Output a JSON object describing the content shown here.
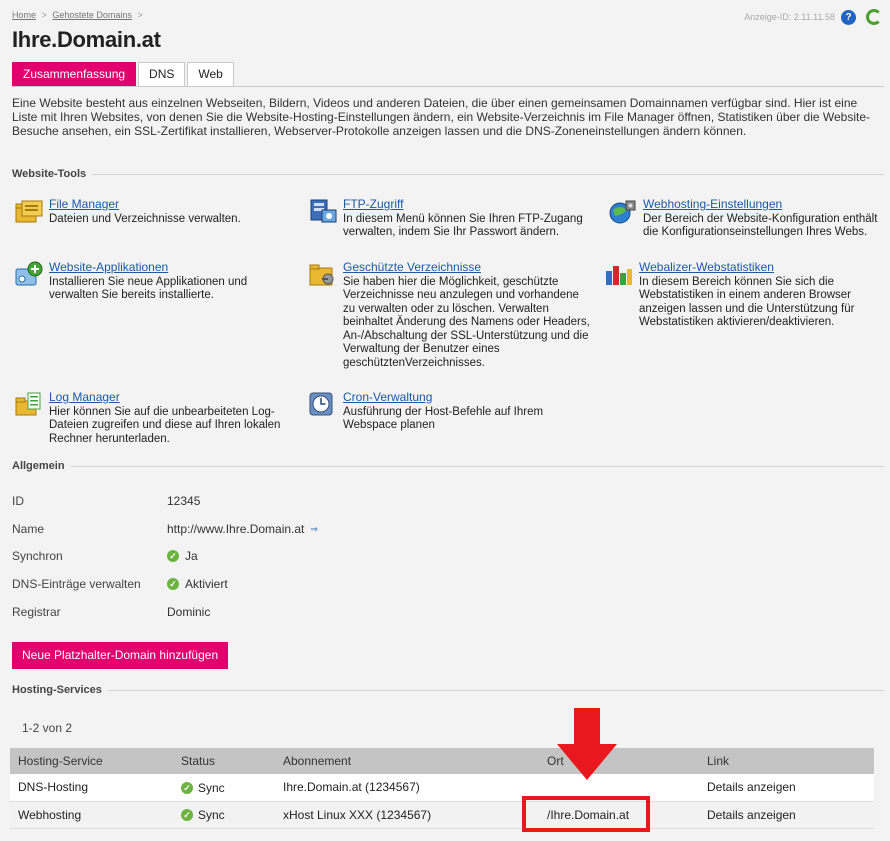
{
  "breadcrumb": {
    "items": [
      "Home",
      "Gehostete Domains"
    ],
    "separator": ">"
  },
  "header": {
    "title": "Ihre.Domain.at",
    "display_id": "Anzeige-ID: 2.11.11.58"
  },
  "tabs": [
    {
      "label": "Zusammenfassung",
      "active": true
    },
    {
      "label": "DNS",
      "active": false
    },
    {
      "label": "Web",
      "active": false
    }
  ],
  "intro": "Eine Website besteht aus einzelnen Webseiten, Bildern, Videos und anderen Dateien, die über einen gemeinsamen Domainnamen verfügbar sind. Hier ist eine Liste mit Ihren Websites, von denen Sie die Website-Hosting-Einstellungen ändern, ein Website-Verzeichnis im File Manager öffnen, Statistiken über die Website-Besuche ansehen, ein SSL-Zertifikat installieren, Webserver-Protokolle anzeigen lassen und die DNS-Zoneneinstellungen ändern können.",
  "tools_section": {
    "title": "Website-Tools",
    "items": [
      {
        "title": "File Manager",
        "desc": "Dateien und Verzeichnisse verwalten."
      },
      {
        "title": "FTP-Zugriff",
        "desc": "In diesem Menü können Sie Ihren FTP-Zugang verwalten, indem Sie Ihr Passwort ändern."
      },
      {
        "title": "Webhosting-Einstellungen",
        "desc": "Der Bereich der Website-Konfiguration enthält die Konfigurationseinstellungen Ihres Webs."
      },
      {
        "title": "Website-Applikationen",
        "desc": "Installieren Sie neue Applikationen und verwalten Sie bereits installierte."
      },
      {
        "title": "Geschützte Verzeichnisse",
        "desc": "Sie haben hier die Möglichkeit, geschützte Verzeichnisse neu anzulegen und vorhandene zu verwalten oder zu löschen. Verwalten beinhaltet Änderung des Namens oder Headers, An-/Abschaltung der SSL-Unterstützung und die Verwaltung der Benutzer eines geschütztenVerzeichnisses."
      },
      {
        "title": "Webalizer-Webstatistiken",
        "desc": "In diesem Bereich können Sie sich die Webstatistiken in einem anderen Browser anzeigen lassen und die Unterstützung für Webstatistiken aktivieren/deaktivieren."
      },
      {
        "title": "Log Manager",
        "desc": "Hier können Sie auf die unbearbeiteten Log-Dateien zugreifen und diese auf Ihren lokalen Rechner herunterladen."
      },
      {
        "title": "Cron-Verwaltung",
        "desc": "Ausführung der Host-Befehle auf Ihrem Webspace planen"
      }
    ]
  },
  "general_section": {
    "title": "Allgemein",
    "rows": [
      {
        "label": "ID",
        "value": "12345"
      },
      {
        "label": "Name",
        "value": "http://www.Ihre.Domain.at"
      },
      {
        "label": "Synchron",
        "value": "Ja"
      },
      {
        "label": "DNS-Einträge verwalten",
        "value": "Aktiviert"
      },
      {
        "label": "Registrar",
        "value": "Dominic"
      }
    ]
  },
  "add_button": "Neue Platzhalter-Domain hinzufügen",
  "hosting_section": {
    "title": "Hosting-Services",
    "pager": "1-2 von 2",
    "columns": [
      "Hosting-Service",
      "Status",
      "Abonnement",
      "Ort",
      "Link"
    ],
    "rows": [
      {
        "service": "DNS-Hosting",
        "status": "Sync",
        "subscription": "Ihre.Domain.at (1234567)",
        "location": "",
        "link": "Details anzeigen"
      },
      {
        "service": "Webhosting",
        "status": "Sync",
        "subscription": "xHost Linux XXX (1234567)",
        "location": "/Ihre.Domain.at",
        "link": "Details anzeigen"
      }
    ]
  },
  "colors": {
    "accent": "#e2006f",
    "link": "#1a5aa6",
    "annotation": "#e8181e",
    "ok": "#6cb33f"
  }
}
